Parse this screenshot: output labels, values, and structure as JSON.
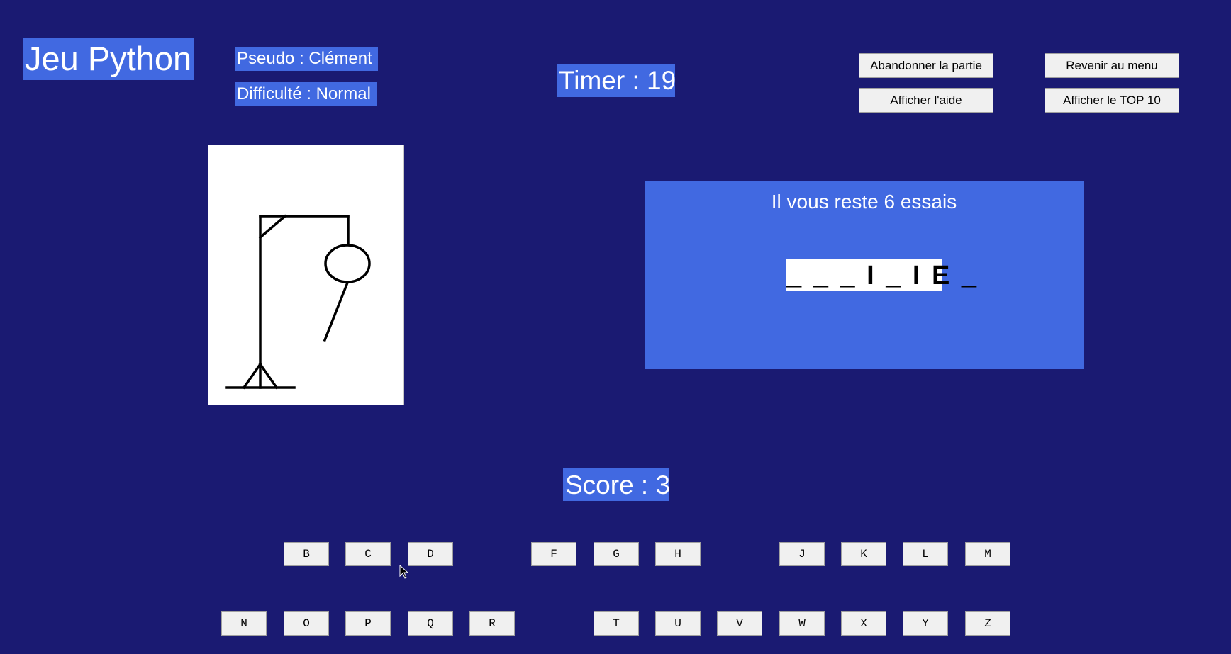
{
  "header": {
    "title": "Jeu Python",
    "pseudo": "Pseudo : Clément",
    "difficulty": "Difficulté : Normal",
    "timer": "Timer : 19"
  },
  "buttons": {
    "abandon": "Abandonner la partie",
    "menu": "Revenir au menu",
    "help": "Afficher l'aide",
    "top10": "Afficher le TOP 10"
  },
  "game": {
    "tries_text": "Il vous reste 6 essais",
    "word": "_ _ _ I _ I E _",
    "score": "Score : 3"
  },
  "keyboard": {
    "row1": [
      "B",
      "C",
      "D",
      "F",
      "G",
      "H",
      "J",
      "K",
      "L",
      "M"
    ],
    "row2": [
      "N",
      "O",
      "P",
      "Q",
      "R",
      "T",
      "U",
      "V",
      "W",
      "X",
      "Y",
      "Z"
    ]
  },
  "colors": {
    "background": "#1a1a72",
    "accent": "#4169e1",
    "button": "#f0f0f0"
  }
}
